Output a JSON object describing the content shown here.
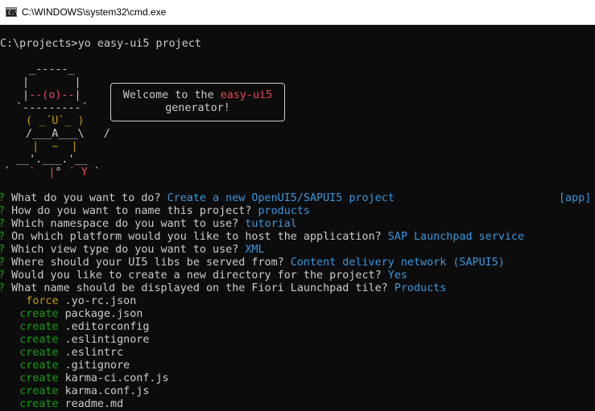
{
  "window": {
    "title": "C:\\WINDOWS\\system32\\cmd.exe",
    "icon": "cmd-icon",
    "icon_glyph": "C:\\"
  },
  "prompt": {
    "text": "C:\\projects>yo easy-ui5 project"
  },
  "yeoman_art": {
    "row1": " _-----_",
    "row2": "|       |",
    "row3_pre": "|",
    "row3_eye": "--(o)--",
    "row3_post": "|",
    "row4": "`---------´",
    "row5": " ( _´U`_ )",
    "row6": " /___A___\\   /",
    "row7_pre": "  |",
    "row7_mid": "  ~  ",
    "row7_post": "|",
    "row8": "__'.___.'__",
    "row9_pre": "´   ",
    "row9_a": "`  |",
    "row9_b": "° ",
    "row9_c": "´ Y",
    "row9_d": " `"
  },
  "welcome": {
    "line1_pre": "Welcome to the ",
    "line1_highlight": "easy-ui5",
    "line2": "generator!"
  },
  "questions": [
    {
      "mark": "?",
      "question": "What do you want to do?",
      "answer": "Create a new OpenUI5/SAPUI5 project",
      "tag": "[app]"
    },
    {
      "mark": "?",
      "question": "How do you want to name this project?",
      "answer": "products"
    },
    {
      "mark": "?",
      "question": "Which namespace do you want to use?",
      "answer": "tutorial"
    },
    {
      "mark": "?",
      "question": "On which platform would you like to host the application?",
      "answer": "SAP Launchpad service"
    },
    {
      "mark": "?",
      "question": "Which view type do you want to use?",
      "answer": "XML"
    },
    {
      "mark": "?",
      "question": "Where should your UI5 libs be served from?",
      "answer": "Content delivery network (SAPUI5)"
    },
    {
      "mark": "?",
      "question": "Would you like to create a new directory for the project?",
      "answer": "Yes"
    },
    {
      "mark": "?",
      "question": "What name should be displayed on the Fiori Launchpad tile?",
      "answer": "Products"
    }
  ],
  "file_ops": [
    {
      "action": "force",
      "file": ".yo-rc.json"
    },
    {
      "action": "create",
      "file": "package.json"
    },
    {
      "action": "create",
      "file": ".editorconfig"
    },
    {
      "action": "create",
      "file": ".eslintignore"
    },
    {
      "action": "create",
      "file": ".eslintrc"
    },
    {
      "action": "create",
      "file": ".gitignore"
    },
    {
      "action": "create",
      "file": "karma-ci.conf.js"
    },
    {
      "action": "create",
      "file": "karma.conf.js"
    },
    {
      "action": "create",
      "file": "readme.md"
    }
  ],
  "colors": {
    "background": "#0c0c0c",
    "text": "#cccccc",
    "question_mark": "#13a10e",
    "answer": "#3a96dd",
    "highlight": "#e74856",
    "force": "#c19c00",
    "create": "#13a10e"
  }
}
